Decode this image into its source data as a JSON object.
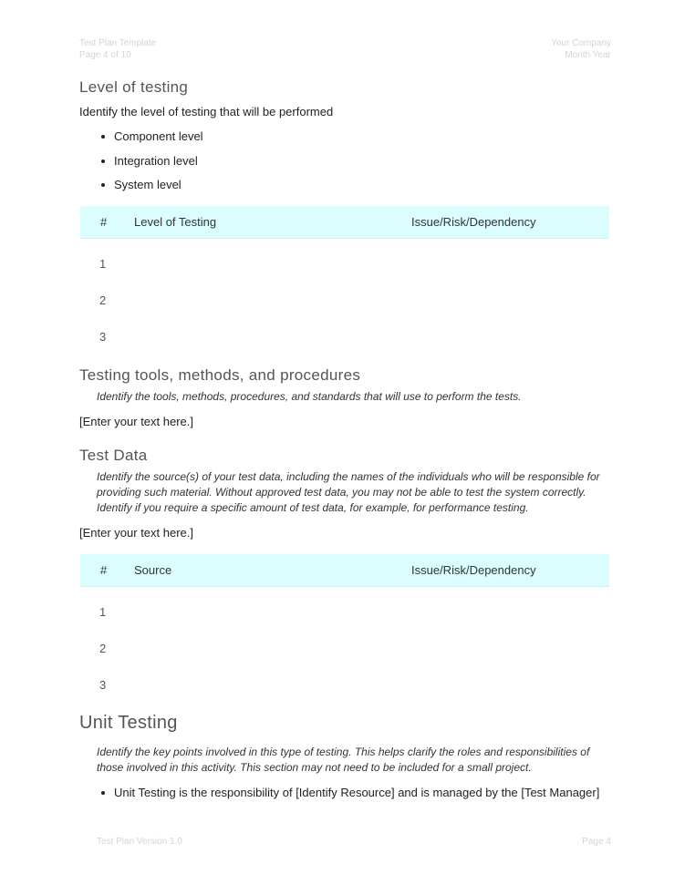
{
  "header": {
    "left_line1": "Test Plan Template",
    "left_line2": "Page 4 of 10",
    "right_line1": "Your Company",
    "right_line2": "Month Year"
  },
  "level_of_testing": {
    "heading": "Level of testing",
    "intro": "Identify the level of testing that will be performed",
    "bullets": [
      "Component level",
      "Integration level",
      "System level"
    ],
    "table": {
      "col1": "#",
      "col2": "Level of Testing",
      "col3": "Issue/Risk/Dependency",
      "rows": [
        "1",
        "2",
        "3"
      ]
    }
  },
  "tools": {
    "heading": "Testing tools, methods, and procedures",
    "instruction": "Identify the tools, methods, procedures, and standards that will use to perform the tests.",
    "placeholder": "[Enter your text here.]"
  },
  "test_data": {
    "heading": "Test Data",
    "instruction": "Identify the source(s) of your test data, including the names of the individuals who will be responsible for providing such material. Without approved test data, you may not be able to test the system correctly. Identify if you require a specific amount of test data, for example, for performance testing.",
    "placeholder": "[Enter your text here.]",
    "table": {
      "col1": "#",
      "col2": "Source",
      "col3": "Issue/Risk/Dependency",
      "rows": [
        "1",
        "2",
        "3"
      ]
    }
  },
  "unit_testing": {
    "heading": "Unit Testing",
    "instruction": "Identify the key points involved in this type of testing. This helps clarify the roles and responsibilities of those involved in this activity. This section may not need to be included for a small project.",
    "bullet": "Unit Testing is the responsibility of [Identify Resource] and is managed by the [Test Manager]"
  },
  "footer": {
    "left": "Test Plan    Version 1.0",
    "right": "Page 4"
  }
}
